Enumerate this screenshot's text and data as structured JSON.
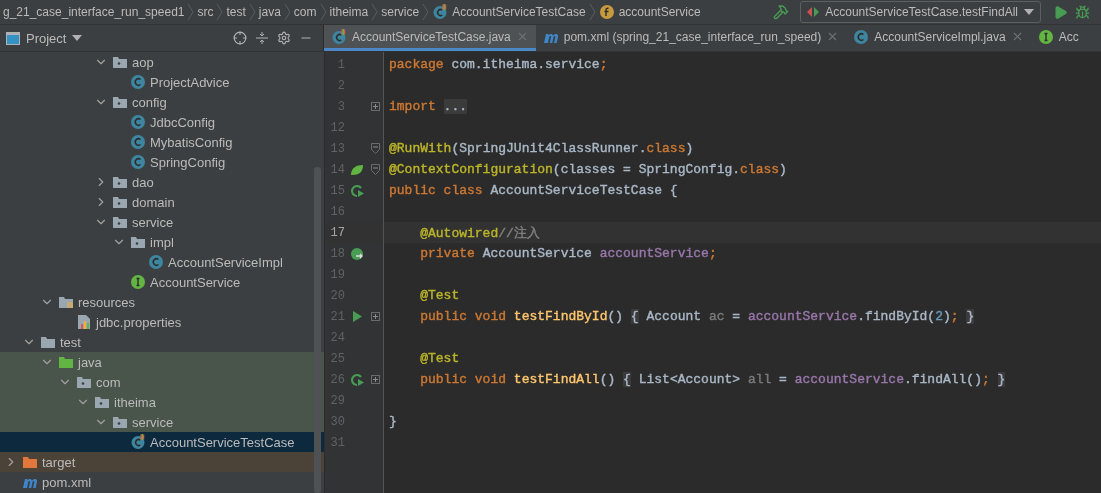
{
  "breadcrumbs": [
    {
      "label": "g_21_case_interface_run_speed1",
      "kind": "project"
    },
    {
      "label": "src",
      "kind": "plain"
    },
    {
      "label": "test",
      "kind": "plain"
    },
    {
      "label": "java",
      "kind": "plain"
    },
    {
      "label": "com",
      "kind": "plain"
    },
    {
      "label": "itheima",
      "kind": "plain"
    },
    {
      "label": "service",
      "kind": "plain"
    },
    {
      "label": "AccountServiceTestCase",
      "kind": "test-class"
    },
    {
      "label": "accountService",
      "kind": "field"
    }
  ],
  "run_config": {
    "label": "AccountServiceTestCase.testFindAll"
  },
  "project_panel": {
    "title": "Project"
  },
  "tabs": [
    {
      "label": "AccountServiceTestCase.java",
      "kind": "test-class",
      "selected": true,
      "closable": true
    },
    {
      "label": "pom.xml (spring_21_case_interface_run_speed)",
      "kind": "maven",
      "selected": false,
      "closable": true
    },
    {
      "label": "AccountServiceImpl.java",
      "kind": "class",
      "selected": false,
      "closable": true
    },
    {
      "label": "Acc",
      "kind": "interface",
      "selected": false,
      "closable": false
    }
  ],
  "tree": [
    {
      "children": [
        {
          "children": [
            {
              "children": [
                {
                  "children": [
                    {
                      "children": [
                        {
                          "label": "aop",
                          "kind": "package",
                          "expanded": true,
                          "selected": false,
                          "children": [
                            {
                              "label": "ProjectAdvice",
                              "kind": "class",
                              "selected": false
                            }
                          ]
                        },
                        {
                          "label": "config",
                          "kind": "package",
                          "expanded": true,
                          "selected": false,
                          "children": [
                            {
                              "label": "JdbcConfig",
                              "kind": "class",
                              "selected": false
                            },
                            {
                              "label": "MybatisConfig",
                              "kind": "class",
                              "selected": false
                            },
                            {
                              "label": "SpringConfig",
                              "kind": "class",
                              "selected": false
                            }
                          ]
                        },
                        {
                          "label": "dao",
                          "kind": "package",
                          "expanded": false,
                          "selected": false
                        },
                        {
                          "label": "domain",
                          "kind": "package",
                          "expanded": false,
                          "selected": false
                        },
                        {
                          "label": "service",
                          "kind": "package",
                          "expanded": true,
                          "selected": false,
                          "children": [
                            {
                              "label": "impl",
                              "kind": "package",
                              "expanded": true,
                              "selected": false,
                              "children": [
                                {
                                  "label": "AccountServiceImpl",
                                  "kind": "class",
                                  "selected": false
                                }
                              ]
                            },
                            {
                              "label": "AccountService",
                              "kind": "interface",
                              "selected": false
                            }
                          ]
                        }
                      ]
                    }
                  ]
                }
              ]
            },
            {
              "label": "resources",
              "kind": "resources",
              "expanded": true,
              "selected": false,
              "children": [
                {
                  "label": "jdbc.properties",
                  "kind": "properties",
                  "selected": false
                }
              ]
            }
          ]
        },
        {
          "label": "test",
          "kind": "folder",
          "expanded": true,
          "selected": false,
          "children": [
            {
              "label": "java",
              "kind": "test-root",
              "expanded": true,
              "selected": false,
              "test_scope": true,
              "children": [
                {
                  "label": "com",
                  "kind": "package",
                  "expanded": true,
                  "selected": false,
                  "test_scope": true,
                  "children": [
                    {
                      "label": "itheima",
                      "kind": "package",
                      "expanded": true,
                      "selected": false,
                      "test_scope": true,
                      "children": [
                        {
                          "label": "service",
                          "kind": "package",
                          "expanded": true,
                          "selected": false,
                          "test_scope": true,
                          "children": [
                            {
                              "label": "AccountServiceTestCase",
                              "kind": "test-class",
                              "selected": true
                            }
                          ]
                        }
                      ]
                    }
                  ]
                }
              ]
            }
          ]
        }
      ]
    },
    {
      "label": "target",
      "kind": "excluded",
      "expanded": false,
      "selected": false
    },
    {
      "label": "pom.xml",
      "kind": "maven",
      "selected": false
    }
  ],
  "editor": {
    "lines": [
      {
        "number": "1",
        "current": false,
        "segments": [
          {
            "text": "package",
            "color": "#cc7832",
            "kind": "code"
          },
          {
            "text": " com.itheima.service",
            "color": "#a9b7c6",
            "kind": "code"
          },
          {
            "text": ";",
            "color": "#cc7832",
            "kind": "code"
          }
        ]
      },
      {
        "number": "2",
        "current": false
      },
      {
        "number": "3",
        "current": false,
        "fold": {
          "kind": "expand"
        },
        "segments": [
          {
            "text": "import ",
            "color": "#cc7832",
            "kind": "code"
          },
          {
            "text": "...",
            "color": "#a9b7c6",
            "kind": "folded"
          }
        ]
      },
      {
        "number": "12",
        "current": false
      },
      {
        "number": "13",
        "current": false,
        "fold": {
          "kind": "collapse"
        },
        "segments": [
          {
            "text": "@RunWith",
            "color": "#bbb529",
            "kind": "code"
          },
          {
            "text": "(SpringJUnit4ClassRunner.",
            "color": "#a9b7c6",
            "kind": "code"
          },
          {
            "text": "class",
            "color": "#cc7832",
            "kind": "code"
          },
          {
            "text": ")",
            "color": "#a9b7c6",
            "kind": "code"
          }
        ]
      },
      {
        "number": "14",
        "current": false,
        "fold": {
          "kind": "collapse"
        },
        "gutter": {
          "kind": "spring"
        },
        "segments": [
          {
            "text": "@ContextConfiguration",
            "color": "#bbb529",
            "kind": "code"
          },
          {
            "text": "(classes = SpringConfig.",
            "color": "#a9b7c6",
            "kind": "code"
          },
          {
            "text": "class",
            "color": "#cc7832",
            "kind": "code"
          },
          {
            "text": ")",
            "color": "#a9b7c6",
            "kind": "code"
          }
        ]
      },
      {
        "number": "15",
        "current": false,
        "gutter": {
          "kind": "run-test"
        },
        "segments": [
          {
            "text": "public class",
            "color": "#cc7832",
            "kind": "code"
          },
          {
            "text": " AccountServiceTestCase {",
            "color": "#a9b7c6",
            "kind": "code"
          }
        ]
      },
      {
        "number": "16",
        "current": false
      },
      {
        "number": "17",
        "current": true,
        "segments": [
          {
            "text": "    @Autowired",
            "color": "#bbb529",
            "kind": "code"
          },
          {
            "text": "//注入",
            "color": "#808080",
            "kind": "code"
          }
        ]
      },
      {
        "number": "18",
        "current": false,
        "gutter": {
          "kind": "autowire"
        },
        "segments": [
          {
            "text": "    private",
            "color": "#cc7832",
            "kind": "code"
          },
          {
            "text": " AccountService ",
            "color": "#a9b7c6",
            "kind": "code"
          },
          {
            "text": "accountService",
            "color": "#9876aa",
            "kind": "code"
          },
          {
            "text": ";",
            "color": "#cc7832",
            "kind": "code"
          }
        ]
      },
      {
        "number": "19",
        "current": false
      },
      {
        "number": "20",
        "current": false,
        "segments": [
          {
            "text": "    @Test",
            "color": "#bbb529",
            "kind": "code"
          }
        ]
      },
      {
        "number": "21",
        "current": false,
        "fold": {
          "kind": "expand"
        },
        "gutter": {
          "kind": "run"
        },
        "segments": [
          {
            "text": "    public void ",
            "color": "#cc7832",
            "kind": "code"
          },
          {
            "text": "testFindById",
            "color": "#ffc66d",
            "kind": "code"
          },
          {
            "text": "() ",
            "color": "#a9b7c6",
            "kind": "code"
          },
          {
            "text": "{",
            "color": "#a9b7c6",
            "kind": "folded"
          },
          {
            "text": " Account ",
            "color": "#a9b7c6",
            "kind": "code"
          },
          {
            "text": "ac",
            "color": "#7a7a7a",
            "kind": "code"
          },
          {
            "text": " = ",
            "color": "#a9b7c6",
            "kind": "code"
          },
          {
            "text": "accountService",
            "color": "#9876aa",
            "kind": "code"
          },
          {
            "text": ".findById(",
            "color": "#a9b7c6",
            "kind": "code"
          },
          {
            "text": "2",
            "color": "#6897bb",
            "kind": "code"
          },
          {
            "text": ")",
            "color": "#a9b7c6",
            "kind": "code"
          },
          {
            "text": "; ",
            "color": "#cc7832",
            "kind": "code"
          },
          {
            "text": "}",
            "color": "#a9b7c6",
            "kind": "folded"
          }
        ]
      },
      {
        "number": "24",
        "current": false
      },
      {
        "number": "25",
        "current": false,
        "segments": [
          {
            "text": "    @Test",
            "color": "#bbb529",
            "kind": "code"
          }
        ]
      },
      {
        "number": "26",
        "current": false,
        "fold": {
          "kind": "expand"
        },
        "gutter": {
          "kind": "run-test"
        },
        "segments": [
          {
            "text": "    public void ",
            "color": "#cc7832",
            "kind": "code"
          },
          {
            "text": "testFindAll",
            "color": "#ffc66d",
            "kind": "code"
          },
          {
            "text": "() ",
            "color": "#a9b7c6",
            "kind": "code"
          },
          {
            "text": "{",
            "color": "#a9b7c6",
            "kind": "folded"
          },
          {
            "text": " List<Account> ",
            "color": "#a9b7c6",
            "kind": "code"
          },
          {
            "text": "all",
            "color": "#7a7a7a",
            "kind": "code"
          },
          {
            "text": " = ",
            "color": "#a9b7c6",
            "kind": "code"
          },
          {
            "text": "accountService",
            "color": "#9876aa",
            "kind": "code"
          },
          {
            "text": ".findAll()",
            "color": "#a9b7c6",
            "kind": "code"
          },
          {
            "text": "; ",
            "color": "#cc7832",
            "kind": "code"
          },
          {
            "text": "}",
            "color": "#a9b7c6",
            "kind": "folded"
          }
        ]
      },
      {
        "number": "29",
        "current": false
      },
      {
        "number": "30",
        "current": false,
        "segments": [
          {
            "text": "}",
            "color": "#a9b7c6",
            "kind": "code"
          }
        ]
      },
      {
        "number": "31",
        "current": false
      }
    ]
  }
}
